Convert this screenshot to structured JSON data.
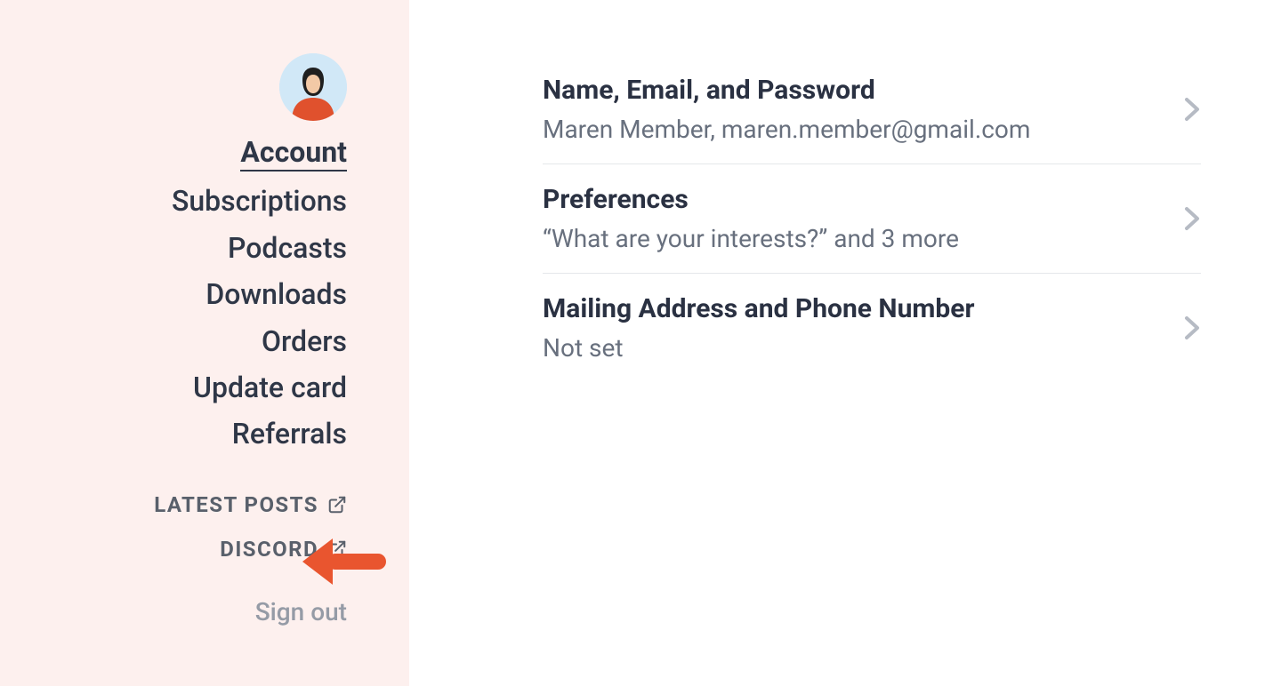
{
  "sidebar": {
    "nav": {
      "account": "Account",
      "subscriptions": "Subscriptions",
      "podcasts": "Podcasts",
      "downloads": "Downloads",
      "orders": "Orders",
      "update_card": "Update card",
      "referrals": "Referrals"
    },
    "ext_links": {
      "latest_posts": "LATEST POSTS",
      "discord": "DISCORD"
    },
    "sign_out": "Sign out"
  },
  "main": {
    "rows": {
      "name": {
        "title": "Name, Email, and Password",
        "sub": "Maren Member, maren.member@gmail.com"
      },
      "prefs": {
        "title": "Preferences",
        "sub": "“What are your interests?” and 3 more"
      },
      "mailing": {
        "title": "Mailing Address and Phone Number",
        "sub": "Not set"
      }
    }
  }
}
